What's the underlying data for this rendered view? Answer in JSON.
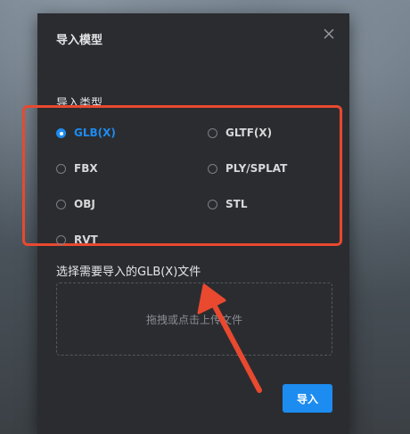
{
  "dialog": {
    "title": "导入模型",
    "close_icon": "close-icon",
    "type_label": "导入类型",
    "options": [
      {
        "label": "GLB(X)",
        "selected": true
      },
      {
        "label": "GLTF(X)",
        "selected": false
      },
      {
        "label": "FBX",
        "selected": false
      },
      {
        "label": "PLY/SPLAT",
        "selected": false
      },
      {
        "label": "OBJ",
        "selected": false
      },
      {
        "label": "STL",
        "selected": false
      },
      {
        "label": "RVT",
        "selected": false
      }
    ],
    "file_label": "选择需要导入的GLB(X)文件",
    "dropzone_text": "拖拽或点击上传文件",
    "import_label": "导入"
  },
  "colors": {
    "accent": "#1d8cf0",
    "highlight": "#e8492f",
    "dialog_bg": "#2b2c30"
  }
}
